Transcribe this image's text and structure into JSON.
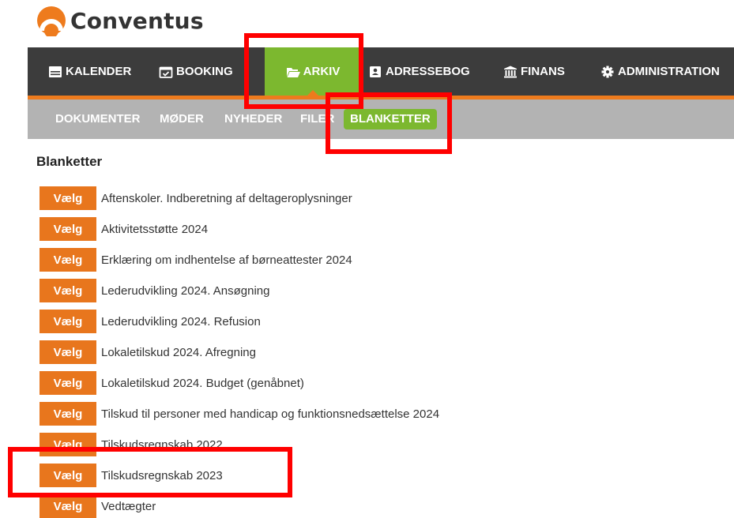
{
  "brand": {
    "name": "Conventus"
  },
  "colors": {
    "accent_orange": "#e8761d",
    "active_green": "#7cb82f",
    "nav_dark": "#3c3c3c",
    "subnav_gray": "#b3b3b3",
    "highlight_red": "#ff0000"
  },
  "topnav": {
    "tabs": [
      {
        "label": "KALENDER",
        "icon": "calendar-icon"
      },
      {
        "label": "BOOKING",
        "icon": "calendar-check-icon"
      },
      {
        "label": "ARKIV",
        "icon": "folder-open-icon",
        "active": true
      },
      {
        "label": "ADRESSEBOG",
        "icon": "address-book-icon"
      },
      {
        "label": "FINANS",
        "icon": "bank-icon"
      },
      {
        "label": "ADMINISTRATION",
        "icon": "gear-icon"
      }
    ]
  },
  "subnav": {
    "items": [
      {
        "label": "DOKUMENTER"
      },
      {
        "label": "MØDER"
      },
      {
        "label": "NYHEDER"
      },
      {
        "label": "FILER"
      },
      {
        "label": "BLANKETTER",
        "active": true
      }
    ]
  },
  "main": {
    "title": "Blanketter",
    "button_label": "Vælg",
    "forms": [
      "Aftenskoler. Indberetning af deltageroplysninger",
      "Aktivitetsstøtte 2024",
      "Erklæring om indhentelse af børneattester 2024",
      "Lederudvikling 2024. Ansøgning",
      "Lederudvikling 2024. Refusion",
      "Lokaletilskud 2024. Afregning",
      "Lokaletilskud 2024. Budget (genåbnet)",
      "Tilskud til personer med handicap og funktionsnedsættelse 2024",
      "Tilskudsregnskab 2022",
      "Tilskudsregnskab 2023",
      "Vedtægter"
    ]
  }
}
